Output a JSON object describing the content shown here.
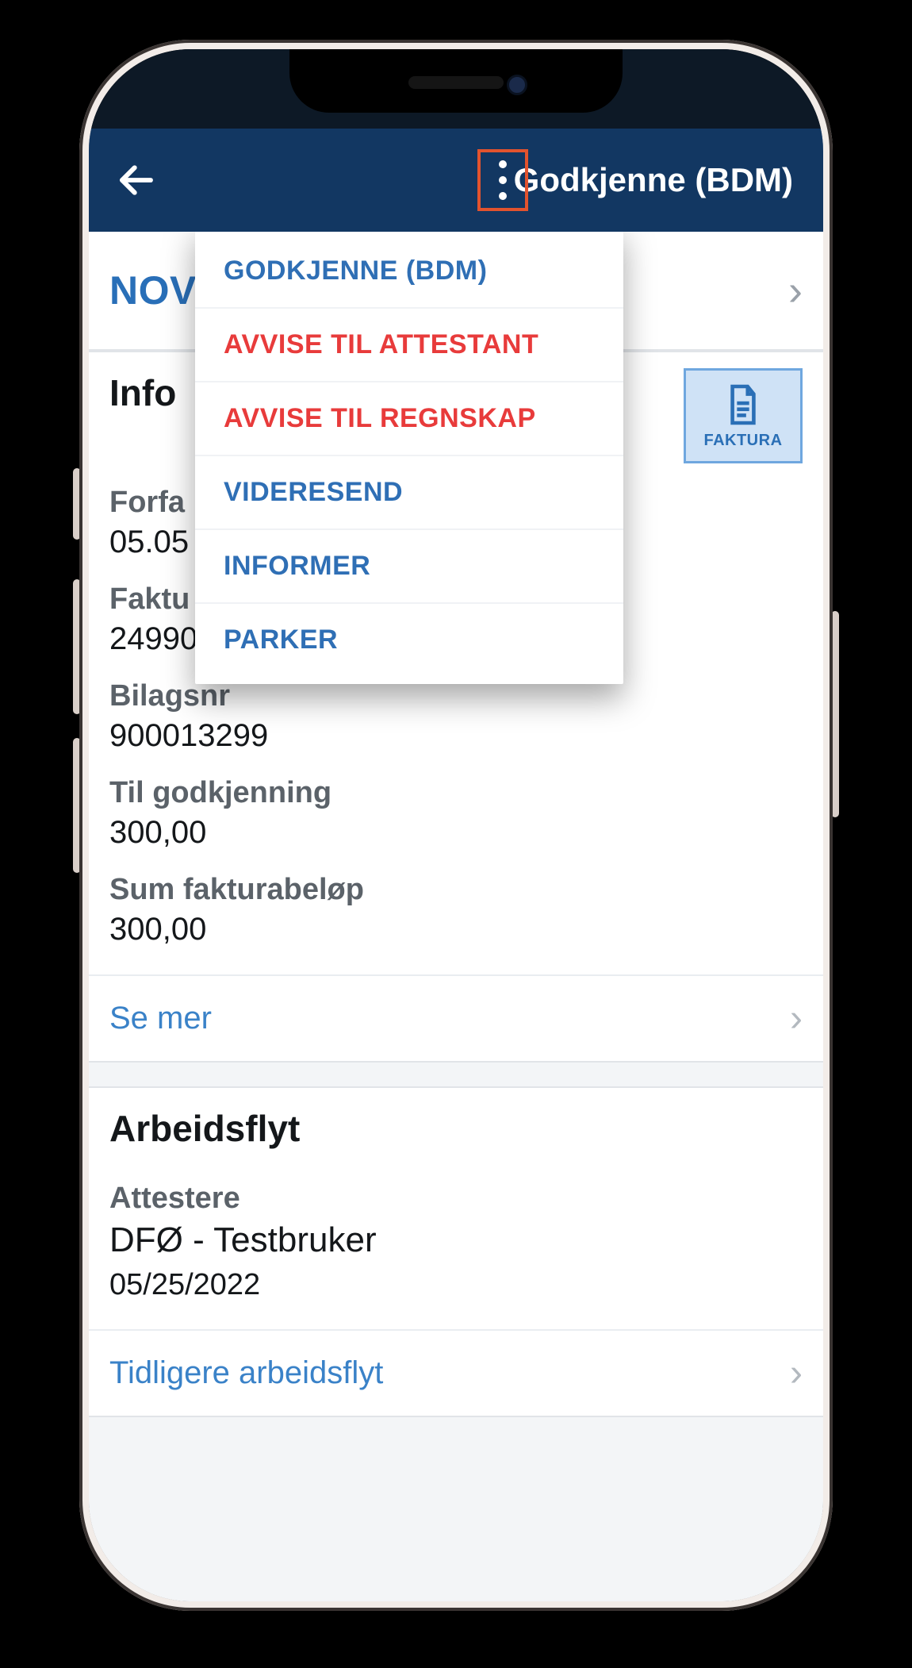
{
  "header": {
    "title": "Godkjenne (BDM)"
  },
  "menu": {
    "items": [
      {
        "label": "GODKJENNE (BDM)",
        "style": "blue"
      },
      {
        "label": "AVVISE TIL ATTESTANT",
        "style": "red"
      },
      {
        "label": "AVVISE TIL REGNSKAP",
        "style": "red"
      },
      {
        "label": "VIDERESEND",
        "style": "blue"
      },
      {
        "label": "INFORMER",
        "style": "blue"
      },
      {
        "label": "PARKER",
        "style": "blue"
      }
    ]
  },
  "vendor": {
    "name": "NOV"
  },
  "info": {
    "title": "Info",
    "faktura_label": "FAKTURA",
    "fields": {
      "forfall_label": "Forfa",
      "forfall_value": "05.05",
      "fakturanr_label": "Faktu",
      "fakturanr_value": "24990.",
      "bilagsnr_label": "Bilagsnr",
      "bilagsnr_value": "900013299",
      "til_godkj_label": "Til godkjenning",
      "til_godkj_value": "300,00",
      "sum_label": "Sum fakturabeløp",
      "sum_value": "300,00"
    },
    "see_more": "Se mer"
  },
  "workflow": {
    "title": "Arbeidsflyt",
    "step": {
      "role": "Attestere",
      "who": "DFØ - Testbruker",
      "when": "05/25/2022"
    },
    "previous": "Tidligere arbeidsflyt"
  }
}
